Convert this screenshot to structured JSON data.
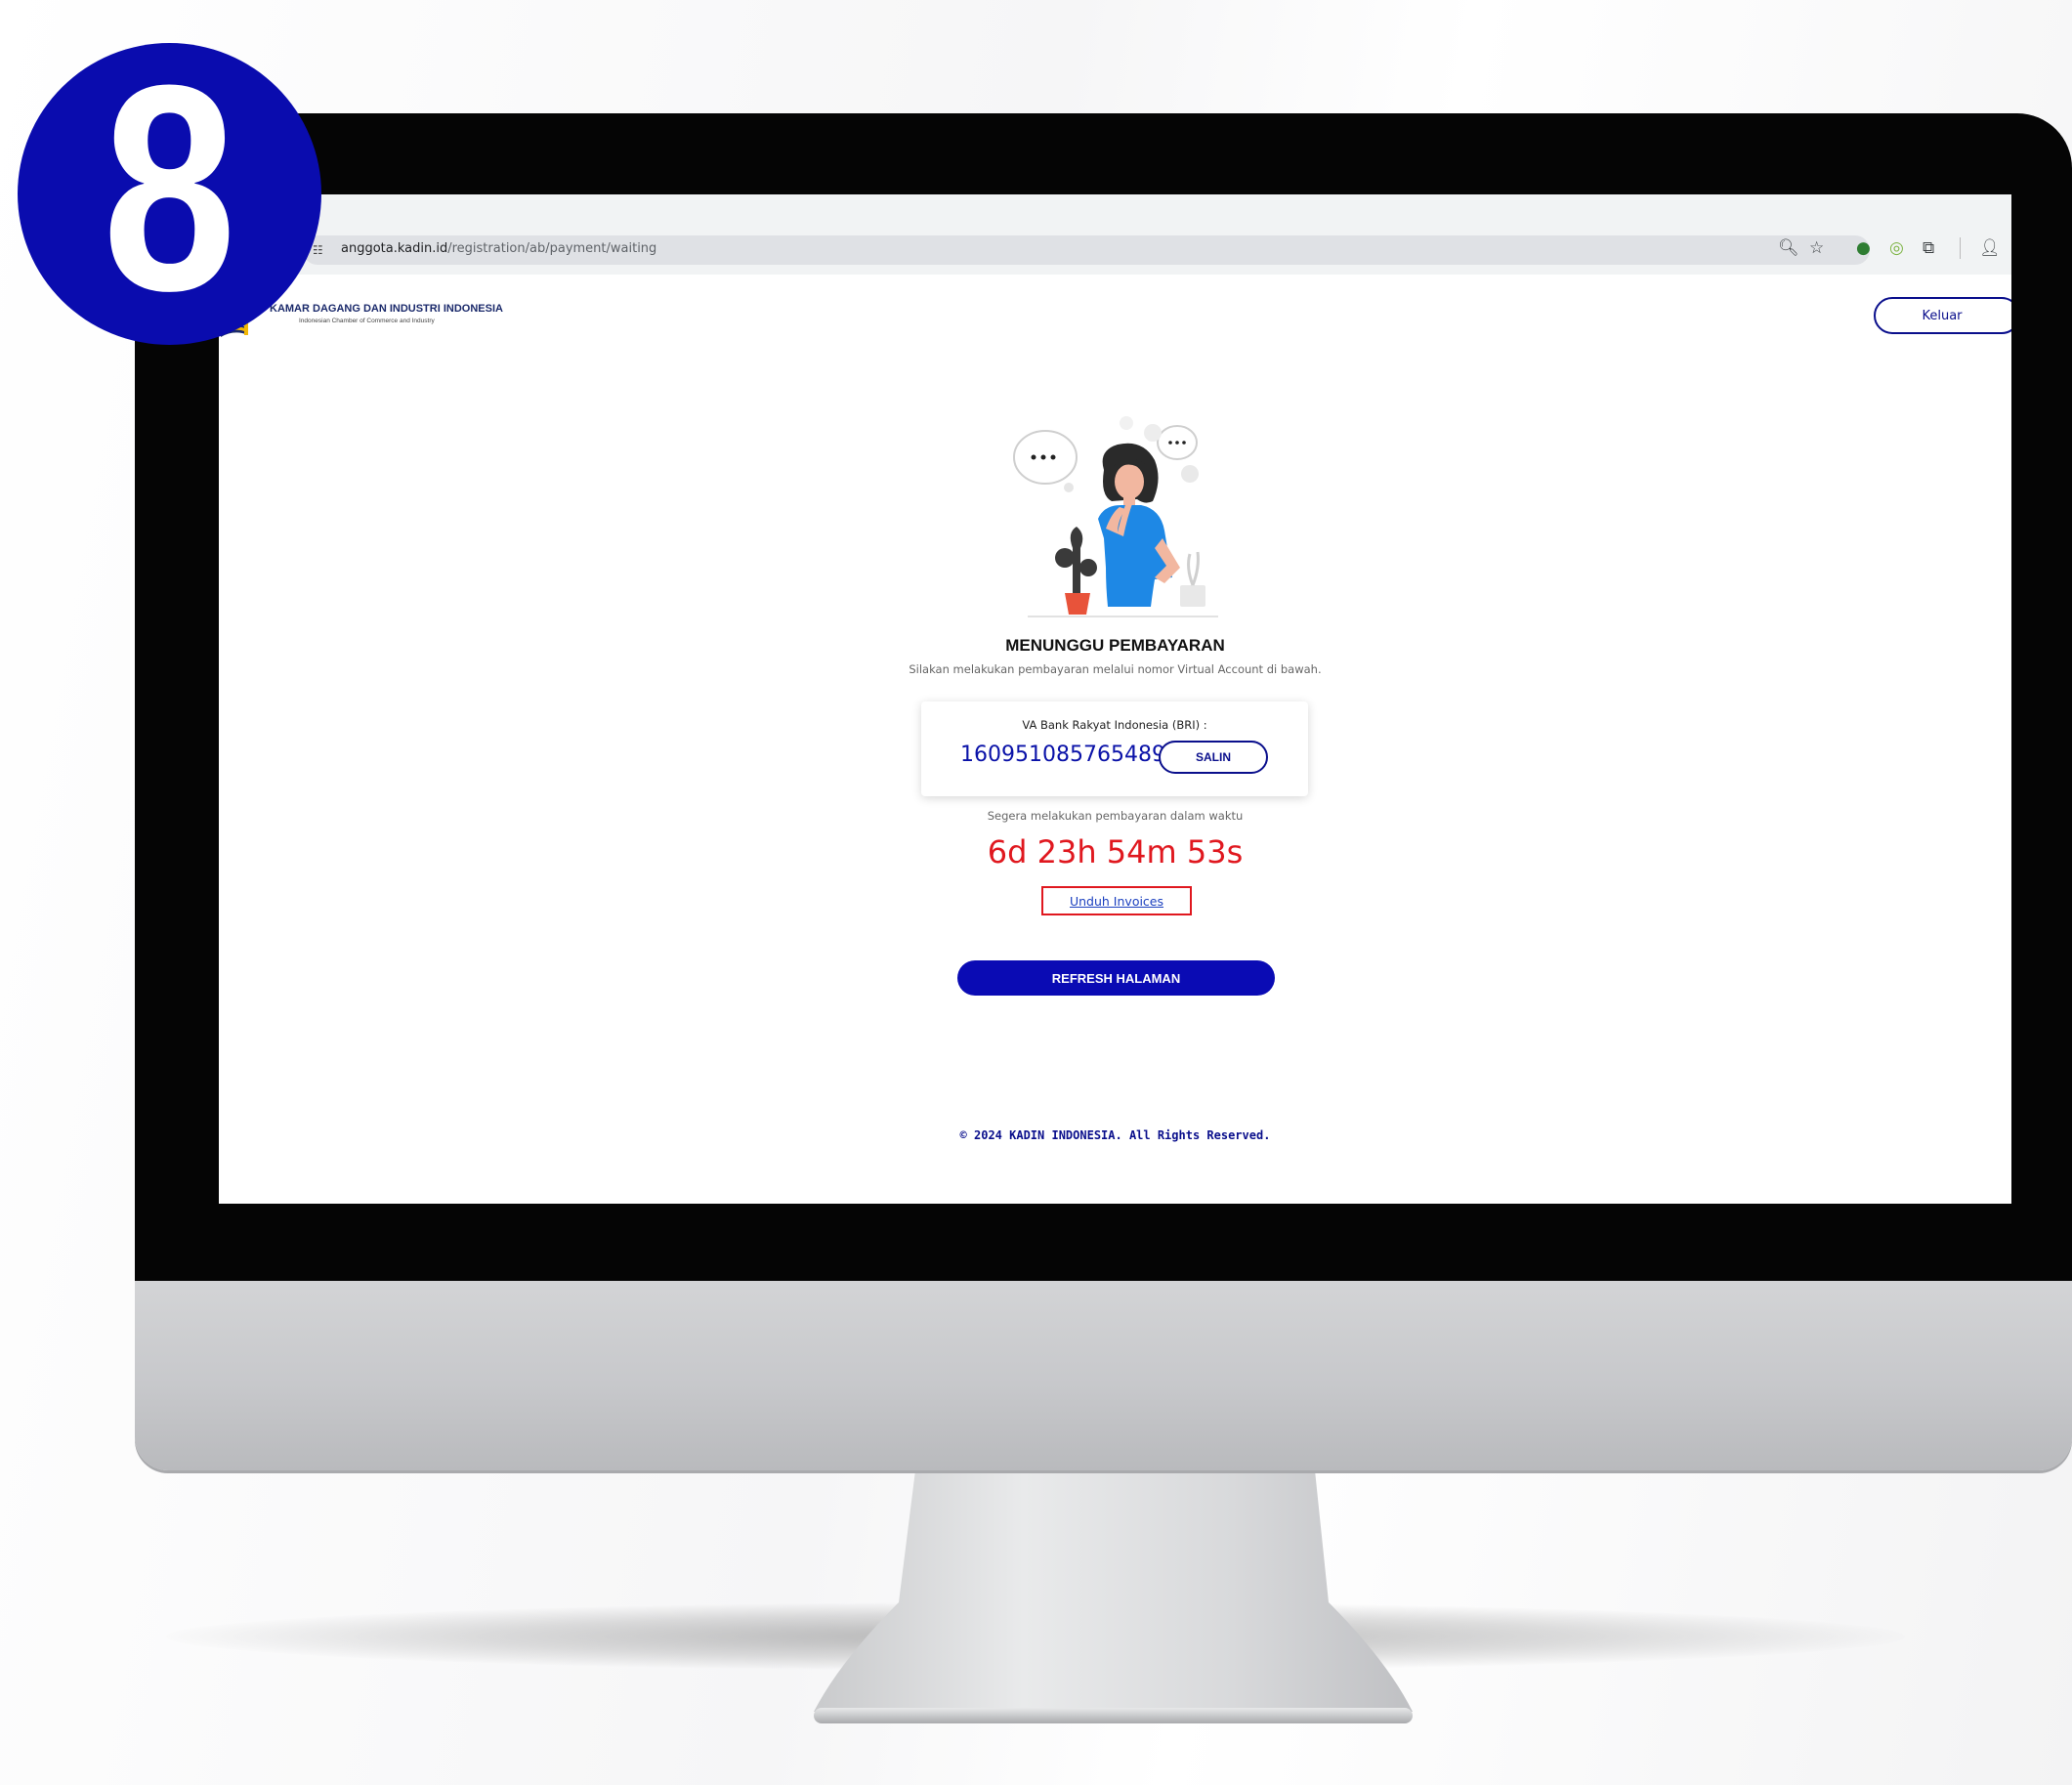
{
  "step_badge": {
    "number": "8",
    "color": "#0a0cae"
  },
  "browser": {
    "url_host": "anggota.kadin.id",
    "url_path": "/registration/ab/payment/waiting",
    "toolbar_icons": [
      "zoom-icon",
      "bookmark-star-icon",
      "extension-globe-icon",
      "extension-chat-icon",
      "extensions-puzzle-icon",
      "profile-icon"
    ]
  },
  "header": {
    "brand_title": "KAMAR DAGANG DAN INDUSTRI INDONESIA",
    "brand_subtitle": "Indonesian Chamber of Commerce and Industry",
    "logout_label": "Keluar"
  },
  "status": {
    "title": "MENUNGGU PEMBAYARAN",
    "description": "Silakan melakukan pembayaran melalui nomor Virtual Account di bawah."
  },
  "virtual_account": {
    "label": "VA Bank Rakyat Indonesia (BRI) :",
    "number": "1609510857654890",
    "copy_label": "SALIN"
  },
  "deadline": {
    "label": "Segera melakukan pembayaran dalam waktu",
    "countdown": "6d 23h 54m 53s"
  },
  "invoice_link": "Unduh Invoices",
  "refresh_label": "REFRESH HALAMAN",
  "footer": "© 2024 KADIN INDONESIA. All Rights Reserved.",
  "colors": {
    "primary": "#0a0bb4",
    "countdown": "#e0181f",
    "link": "#1a3fbf"
  }
}
